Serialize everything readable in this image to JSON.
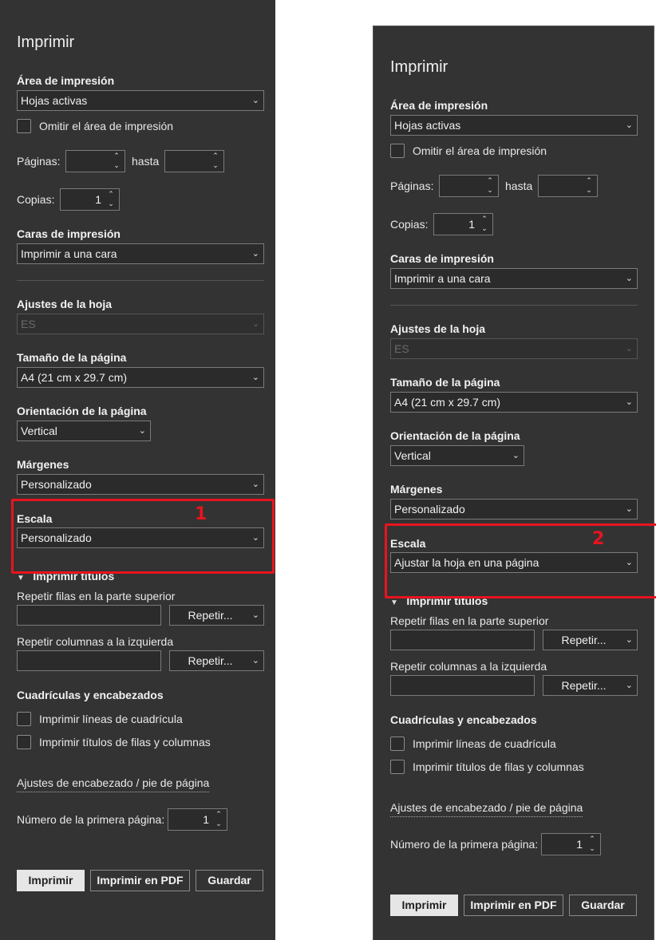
{
  "panels": [
    {
      "title": "Imprimir",
      "print_area": {
        "label": "Área de impresión",
        "value": "Hojas activas"
      },
      "ignore_print_area": "Omitir el área de impresión",
      "pages": {
        "label": "Páginas:",
        "to_label": "hasta",
        "from_value": "",
        "to_value": ""
      },
      "copies": {
        "label": "Copias:",
        "value": "1"
      },
      "sides": {
        "label": "Caras de impresión",
        "value": "Imprimir a una cara"
      },
      "sheet_settings": {
        "label": "Ajustes de la hoja",
        "value": "ES"
      },
      "page_size": {
        "label": "Tamaño de la página",
        "value": "A4 (21 cm x 29.7 cm)"
      },
      "orientation": {
        "label": "Orientación de la página",
        "value": "Vertical"
      },
      "margins": {
        "label": "Márgenes",
        "value": "Personalizado"
      },
      "scale": {
        "label": "Escala",
        "value": "Personalizado"
      },
      "annotation_number": "1",
      "print_titles": {
        "label": "Imprimir títulos",
        "rows_label": "Repetir filas en la parte superior",
        "cols_label": "Repetir columnas a la izquierda",
        "repeat_button": "Repetir..."
      },
      "gridlines": {
        "label": "Cuadrículas y encabezados",
        "print_gridlines": "Imprimir líneas de cuadrícula",
        "print_headings": "Imprimir títulos de filas y columnas"
      },
      "header_footer_link": "Ajustes de encabezado / pie de página",
      "first_page": {
        "label": "Número de la primera página:",
        "value": "1"
      },
      "buttons": {
        "print": "Imprimir",
        "print_pdf": "Imprimir en PDF",
        "save": "Guardar"
      }
    },
    {
      "title": "Imprimir",
      "print_area": {
        "label": "Área de impresión",
        "value": "Hojas activas"
      },
      "ignore_print_area": "Omitir el área de impresión",
      "pages": {
        "label": "Páginas:",
        "to_label": "hasta",
        "from_value": "",
        "to_value": ""
      },
      "copies": {
        "label": "Copias:",
        "value": "1"
      },
      "sides": {
        "label": "Caras de impresión",
        "value": "Imprimir a una cara"
      },
      "sheet_settings": {
        "label": "Ajustes de la hoja",
        "value": "ES"
      },
      "page_size": {
        "label": "Tamaño de la página",
        "value": "A4 (21 cm x 29.7 cm)"
      },
      "orientation": {
        "label": "Orientación de la página",
        "value": "Vertical"
      },
      "margins": {
        "label": "Márgenes",
        "value": "Personalizado"
      },
      "scale": {
        "label": "Escala",
        "value": "Ajustar la hoja en una página"
      },
      "annotation_number": "2",
      "print_titles": {
        "label": "Imprimir títulos",
        "rows_label": "Repetir filas en la parte superior",
        "cols_label": "Repetir columnas a la izquierda",
        "repeat_button": "Repetir..."
      },
      "gridlines": {
        "label": "Cuadrículas y encabezados",
        "print_gridlines": "Imprimir líneas de cuadrícula",
        "print_headings": "Imprimir títulos de filas y columnas"
      },
      "header_footer_link": "Ajustes de encabezado / pie de página",
      "first_page": {
        "label": "Número de la primera página:",
        "value": "1"
      },
      "buttons": {
        "print": "Imprimir",
        "print_pdf": "Imprimir en PDF",
        "save": "Guardar"
      }
    }
  ],
  "colors": {
    "panel_bg": "#333333",
    "highlight": "#e8141e",
    "primary_button": "#e6e6e6"
  },
  "icons": {
    "dropdown": "chevron-down-icon",
    "spinner_up": "chevron-up-icon",
    "spinner_down": "chevron-down-icon",
    "collapse": "triangle-down-icon"
  }
}
